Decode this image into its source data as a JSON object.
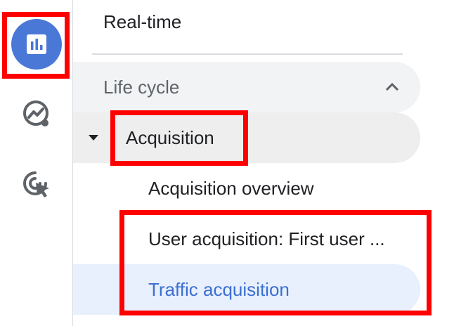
{
  "rail": {
    "items": [
      {
        "icon": "bar-chart-icon",
        "active": true
      },
      {
        "icon": "explore-insights-icon",
        "active": false
      },
      {
        "icon": "advertising-target-icon",
        "active": false
      }
    ]
  },
  "nav": {
    "realtime_label": "Real-time",
    "section_label": "Life cycle",
    "group_label": "Acquisition",
    "items": [
      {
        "label": "Acquisition overview"
      },
      {
        "label": "User acquisition: First user ..."
      },
      {
        "label": "Traffic acquisition",
        "selected": true
      }
    ]
  },
  "colors": {
    "accent": "#4a78d6",
    "selected_text": "#3b6fd1",
    "selected_bg": "#e8f0fe",
    "highlight_border": "#ff0000"
  }
}
